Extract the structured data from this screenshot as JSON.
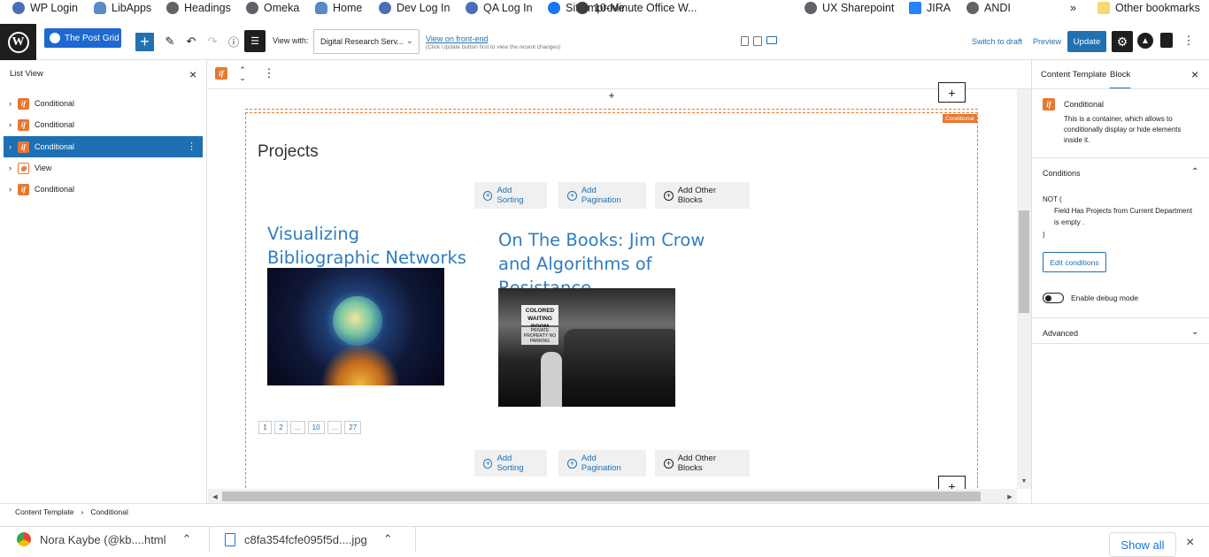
{
  "bookmarks": [
    {
      "label": "WP Login",
      "icon": "wordpress-icon"
    },
    {
      "label": "LibApps",
      "icon": "cloud-icon"
    },
    {
      "label": "Headings",
      "icon": "globe-icon"
    },
    {
      "label": "Omeka",
      "icon": "globe-icon"
    },
    {
      "label": "Home",
      "icon": "cloud-icon"
    },
    {
      "label": "Dev Log In",
      "icon": "wordpress-icon"
    },
    {
      "label": "QA Log In",
      "icon": "wordpress-icon"
    },
    {
      "label": "SiteImprove",
      "icon": "facebook-icon"
    },
    {
      "label": "10-Minute Office W...",
      "icon": "google-icon"
    },
    {
      "label": "UX Sharepoint",
      "icon": "globe-icon"
    },
    {
      "label": "JIRA",
      "icon": "jira-icon"
    },
    {
      "label": "ANDI",
      "icon": "globe-icon"
    }
  ],
  "bookmarks_overflow": "»",
  "other_bookmarks": "Other bookmarks",
  "toolbar": {
    "post_grid_label": "The Post Grid",
    "add_label": "+",
    "view_with_label": "View with:",
    "view_with_value": "Digital Research Serv...",
    "view_front_end": "View on front-end",
    "view_front_end_note": "(Click Update button first to view the recent changes)",
    "switch_to_draft": "Switch to draft",
    "preview": "Preview",
    "update": "Update"
  },
  "list_view": {
    "title": "List View",
    "items": [
      {
        "label": "Conditional",
        "selected": false
      },
      {
        "label": "Conditional",
        "selected": false
      },
      {
        "label": "Conditional",
        "selected": true
      },
      {
        "label": "View",
        "selected": false
      },
      {
        "label": "Conditional",
        "selected": false
      }
    ]
  },
  "canvas": {
    "conditional_badge": "Conditional",
    "section_title": "Projects",
    "view_buttons": {
      "sorting": "Add Sorting",
      "pagination": "Add Pagination",
      "other": "Add Other Blocks"
    },
    "posts": [
      {
        "title": "Visualizing Bibliographic Networks"
      },
      {
        "title": "On The Books: Jim Crow and Algorithms of Resistance"
      }
    ],
    "image2_sign_top": "COLORED WAITING ROOM",
    "image2_sign_bottom": "PRIVATE PROPERTY NO PARKING",
    "pagination": [
      "1",
      "2",
      "...",
      "10",
      "...",
      "27"
    ]
  },
  "sidebar": {
    "tab_template": "Content Template",
    "tab_block": "Block",
    "block_name": "Conditional",
    "block_description": "This is a container, which allows to conditionally display or hide elements inside it.",
    "conditions_title": "Conditions",
    "condition_not": "NOT (",
    "condition_field": "Field Has Projects from Current Department is empty .",
    "condition_close": ")",
    "edit_conditions": "Edit conditions",
    "debug_label": "Enable debug mode",
    "debug_enabled": false,
    "advanced_title": "Advanced"
  },
  "breadcrumb": {
    "root": "Content Template",
    "current": "Conditional"
  },
  "downloads": {
    "item1": "Nora Kaybe (@kb....html",
    "item2": "c8fa354fcfe095f5d....jpg",
    "show_all": "Show all"
  },
  "colors": {
    "accent": "#2271b1",
    "toolset_orange": "#e8782f",
    "selected": "#1e6fb3"
  }
}
